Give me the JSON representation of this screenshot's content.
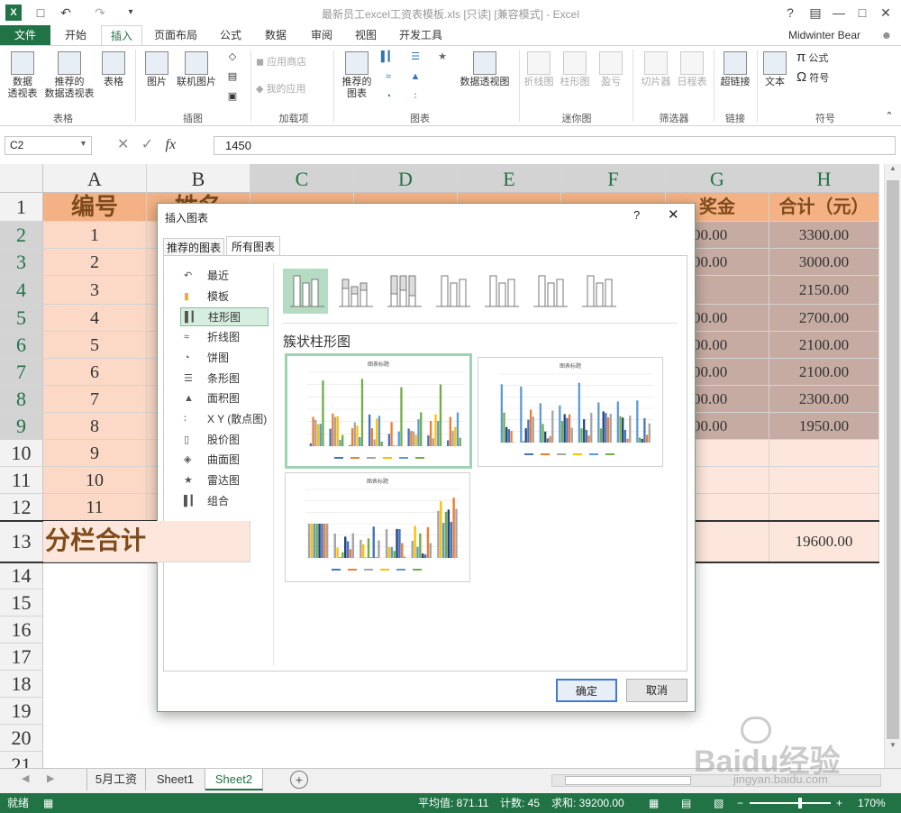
{
  "window": {
    "title": "最新员工excel工资表模板.xls  [只读]  [兼容模式] - Excel",
    "help": "?",
    "user": "Midwinter Bear"
  },
  "ribbon_tabs": [
    "文件",
    "开始",
    "插入",
    "页面布局",
    "公式",
    "数据",
    "审阅",
    "视图",
    "开发工具"
  ],
  "ribbon": {
    "pivot": "数据\n透视表",
    "rec_pivot": "推荐的\n数据透视表",
    "table": "表格",
    "group_tables": "表格",
    "picture": "图片",
    "online_picture": "联机图片",
    "group_illustrations": "插图",
    "store": "应用商店",
    "my_apps": "我的应用",
    "group_addins": "加载项",
    "rec_charts": "推荐的\n图表",
    "pivot_chart": "数据透视图",
    "group_charts": "图表",
    "spark_line": "折线图",
    "spark_column": "柱形图",
    "spark_winloss": "盈亏",
    "group_sparklines": "迷你图",
    "slicer": "切片器",
    "timeline": "日程表",
    "group_filters": "筛选器",
    "hyperlink": "超链接",
    "group_links": "链接",
    "text": "文本",
    "equation": "公式",
    "symbol": "符号",
    "group_symbols": "符号"
  },
  "formula_bar": {
    "name_box": "C2",
    "fx": "fx",
    "formula": "1450"
  },
  "columns": [
    "A",
    "B",
    "C",
    "D",
    "E",
    "F",
    "G",
    "H"
  ],
  "rows": [
    "1",
    "2",
    "3",
    "4",
    "5",
    "6",
    "7",
    "8",
    "9",
    "10",
    "11",
    "12",
    "13",
    "14",
    "15",
    "16",
    "17",
    "18",
    "19",
    "20",
    "21"
  ],
  "sheet": {
    "header_a": "编号",
    "header_b": "姓名",
    "header_g": "奖金",
    "header_h": "合计（元）",
    "ids": [
      "1",
      "2",
      "3",
      "4",
      "5",
      "6",
      "7",
      "8",
      "9",
      "10",
      "11"
    ],
    "g_partial": [
      "00.00",
      "00.00",
      "",
      "00.00",
      "00.00",
      "00.00",
      "00.00",
      "00.00"
    ],
    "totals": [
      "3300.00",
      "3000.00",
      "2150.00",
      "2700.00",
      "2100.00",
      "2100.00",
      "2300.00",
      "1950.00"
    ],
    "subtotal_label": "分栏合计",
    "grand_total": "19600.00"
  },
  "sheet_tabs": [
    "5月工资",
    "Sheet1",
    "Sheet2"
  ],
  "status": {
    "ready": "就绪",
    "average": "平均值: 871.11",
    "count": "计数: 45",
    "sum": "求和: 39200.00",
    "zoom": "170%"
  },
  "dialog": {
    "title": "插入图表",
    "help": "?",
    "tabs": [
      "推荐的图表",
      "所有图表"
    ],
    "nav": [
      "最近",
      "模板",
      "柱形图",
      "折线图",
      "饼图",
      "条形图",
      "面积图",
      "X Y (散点图)",
      "股价图",
      "曲面图",
      "雷达图",
      "组合"
    ],
    "subtype_title": "簇状柱形图",
    "preview_title": "图表标题",
    "ok": "确定",
    "cancel": "取消"
  },
  "watermark": "Baidu经验",
  "watermark_url": "jingyan.baidu.com"
}
